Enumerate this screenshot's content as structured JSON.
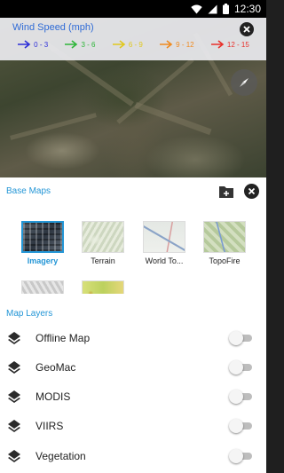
{
  "status_bar": {
    "time": "12:30"
  },
  "legend": {
    "title": "Wind Speed (mph)",
    "items": [
      {
        "label": "0 - 3",
        "color": "#2d2fd8"
      },
      {
        "label": "3 - 6",
        "color": "#2fb63a"
      },
      {
        "label": "6 - 9",
        "color": "#e0c81e"
      },
      {
        "label": "9 - 12",
        "color": "#ef8a1f"
      },
      {
        "label": "12 - 15",
        "color": "#e8302a"
      }
    ]
  },
  "base_maps": {
    "title": "Base Maps",
    "items": [
      {
        "label": "Imagery",
        "selected": true
      },
      {
        "label": "Terrain",
        "selected": false
      },
      {
        "label": "World To...",
        "selected": false
      },
      {
        "label": "TopoFire",
        "selected": false
      }
    ]
  },
  "map_layers": {
    "title": "Map Layers",
    "items": [
      {
        "label": "Offline Map",
        "enabled": false
      },
      {
        "label": "GeoMac",
        "enabled": false
      },
      {
        "label": "MODIS",
        "enabled": false
      },
      {
        "label": "VIIRS",
        "enabled": false
      },
      {
        "label": "Vegetation",
        "enabled": false
      }
    ]
  },
  "colors": {
    "accent": "#2496d6",
    "legend_title": "#2f6bd6"
  },
  "icons": [
    "wifi-icon",
    "signal-icon",
    "battery-icon",
    "close-icon",
    "compass-icon",
    "add-folder-icon",
    "layers-icon"
  ]
}
